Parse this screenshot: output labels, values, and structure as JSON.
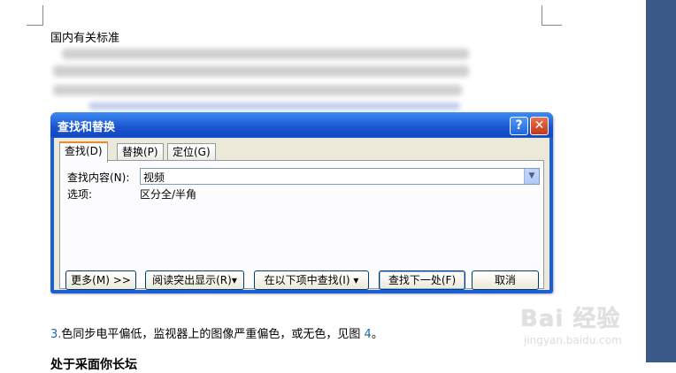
{
  "document": {
    "heading": "国内有关标准",
    "paragraph_prefix": "3.",
    "paragraph_text": "色同步电平偏低，监视器上的图像严重偏色，或无色，见图 ",
    "paragraph_fig": "4",
    "paragraph_end": "。",
    "cut_heading": "处于采面你长坛"
  },
  "dialog": {
    "title": "查找和替换",
    "help_icon": "?",
    "close_icon": "✕",
    "tabs": [
      {
        "label": "查找(D)"
      },
      {
        "label": "替换(P)"
      },
      {
        "label": "定位(G)"
      }
    ],
    "find_label": "查找内容(N):",
    "find_value": "视频",
    "options_label": "选项:",
    "options_value": "区分全/半角",
    "buttons": {
      "more": "更多(M) >>",
      "reading_highlight": "阅读突出显示(R)▾",
      "find_in": "在以下项中查找(I) ▾",
      "find_next": "查找下一处(F)",
      "cancel": "取消"
    }
  },
  "watermark": {
    "logo": "Bai 经验",
    "url": "jingyan.baidu.com"
  },
  "colors": {
    "titlebar": "#1a55d0",
    "dialog_bg": "#ece9d8",
    "tab_accent": "#e68b2c",
    "close_button": "#c1391a"
  }
}
